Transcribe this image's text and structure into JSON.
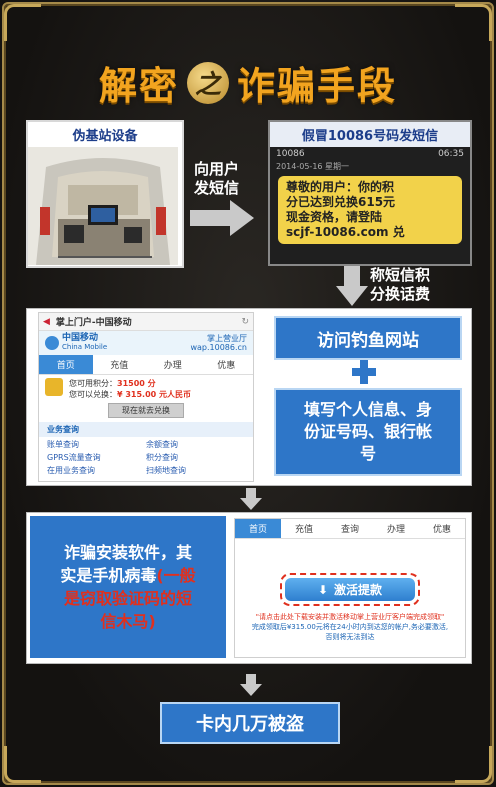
{
  "title": {
    "left": "解密",
    "mid": "之",
    "right": "诈骗手段"
  },
  "step1": {
    "photo_caption": "伪基站设备",
    "arrow_label": [
      "向用户",
      "发短信"
    ],
    "sms_caption": "假冒10086号码发短信",
    "sms_sender": "10086",
    "sms_date": "2014-05-16 星期一",
    "sms_time": "06:35",
    "sms_text": [
      "尊敬的用户：你的积",
      "分已达到兑换615元",
      "现金资格，请登陆",
      "scjf-10086.com 兑"
    ]
  },
  "step2": {
    "arrow_label": [
      "称短信积",
      "分换话费"
    ],
    "phone": {
      "titlebar": "掌上门户-中国移动",
      "logo": "中国移动",
      "logo_en": "China Mobile",
      "portal": "掌上营业厅",
      "portal_url": "wap.10086.cn",
      "tabs": [
        "首页",
        "充值",
        "办理",
        "优惠"
      ],
      "points_label": "您可用积分：",
      "points_value": "31500 分",
      "redeem_label": "您可以兑换：",
      "redeem_value": "¥ 315.00 元人民币",
      "redeem_btn": "现在就去兑换",
      "section": "业务查询",
      "links": [
        "账单查询",
        "余额查询",
        "GPRS流量查询",
        "积分查询",
        "在用业务查询",
        "扫频地查询"
      ]
    },
    "box1": "访问钓鱼网站",
    "box2": [
      "填写个人信息、身",
      "份证号码、银行帐",
      "号"
    ]
  },
  "step3": {
    "box_lines": [
      "诈骗安装软件，其",
      "实是手机病毒"
    ],
    "box_red": [
      "(一般",
      "是窃取验证码的短",
      "信木马)"
    ],
    "tabs": [
      "首页",
      "充值",
      "查询",
      "办理",
      "优惠"
    ],
    "activate_btn": "激活提款",
    "notice": [
      "\"请点击此处下载安装并激活移动掌上营业厅客户端完成领取\"",
      "完成领取后¥315.00元将在24小时内到达您的帐户,务必要激活,",
      "否则将无法到达"
    ]
  },
  "final": "卡内几万被盗",
  "colors": {
    "gold": "#f2a41f",
    "blue": "#2e76c8",
    "arrow": "#c9c9c9",
    "red": "#e0301e"
  }
}
